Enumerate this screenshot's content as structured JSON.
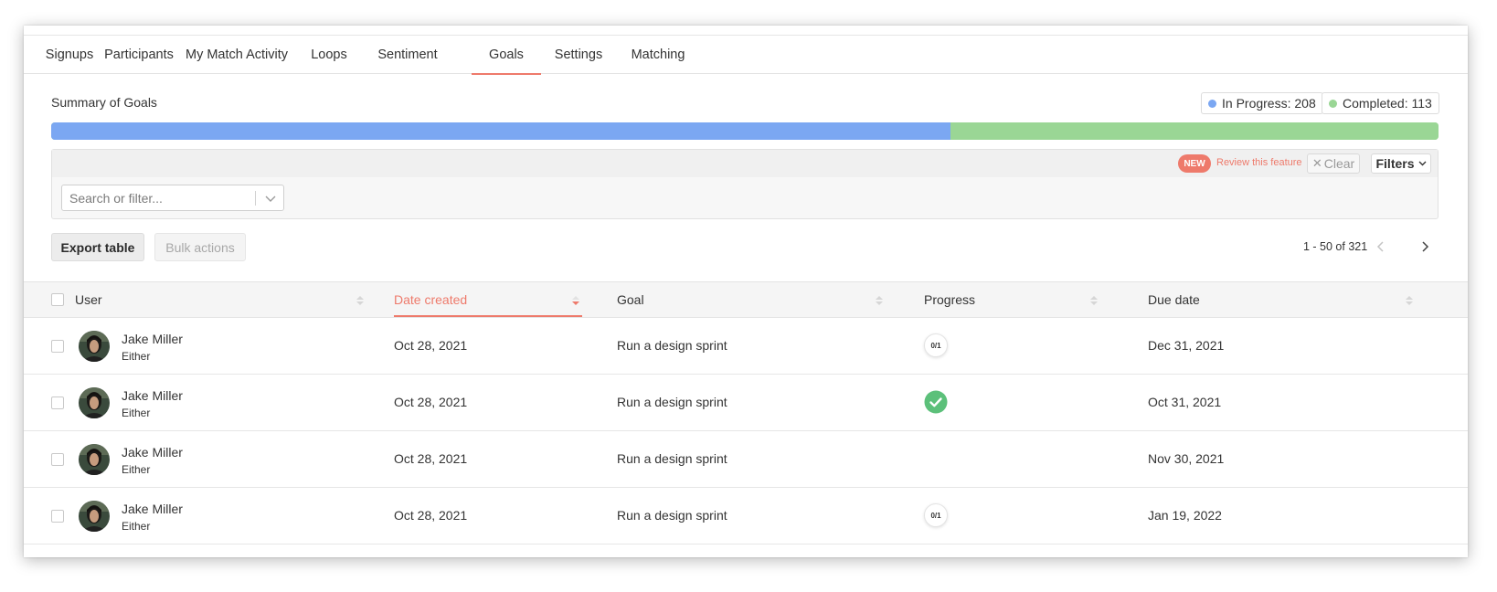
{
  "tabs": [
    {
      "label": "Signups"
    },
    {
      "label": "Participants"
    },
    {
      "label": "My Match Activity"
    },
    {
      "label": "Loops"
    },
    {
      "label": "Sentiment"
    },
    {
      "label": "Goals",
      "active": true
    },
    {
      "label": "Settings"
    },
    {
      "label": "Matching"
    }
  ],
  "summary": {
    "title": "Summary of Goals",
    "in_progress_label": "In Progress: 208",
    "completed_label": "Completed: 113",
    "in_progress_count": 208,
    "completed_count": 113,
    "in_progress_color": "#7ba7f2",
    "completed_color": "#9ad695"
  },
  "filter": {
    "new_badge": "NEW",
    "review_link": "Review this feature",
    "clear_label": "Clear",
    "filters_label": "Filters",
    "search_placeholder": "Search or filter..."
  },
  "toolbar": {
    "export_label": "Export table",
    "bulk_label": "Bulk actions",
    "pager_text": "1 - 50 of 321"
  },
  "table": {
    "columns": {
      "user": "User",
      "date_created": "Date created",
      "goal": "Goal",
      "progress": "Progress",
      "due_date": "Due date"
    },
    "rows": [
      {
        "name": "Jake Miller",
        "role": "Either",
        "date_created": "Oct 28, 2021",
        "goal": "Run a design sprint",
        "progress": "0/1",
        "progress_state": "partial",
        "due_date": "Dec 31, 2021"
      },
      {
        "name": "Jake Miller",
        "role": "Either",
        "date_created": "Oct 28, 2021",
        "goal": "Run a design sprint",
        "progress": "",
        "progress_state": "complete",
        "due_date": "Oct 31, 2021"
      },
      {
        "name": "Jake Miller",
        "role": "Either",
        "date_created": "Oct 28, 2021",
        "goal": "Run a design sprint",
        "progress": "",
        "progress_state": "none",
        "due_date": "Nov 30, 2021"
      },
      {
        "name": "Jake Miller",
        "role": "Either",
        "date_created": "Oct 28, 2021",
        "goal": "Run a design sprint",
        "progress": "0/1",
        "progress_state": "partial",
        "due_date": "Jan 19, 2022"
      }
    ]
  },
  "colors": {
    "accent": "#ee7a6b",
    "success": "#5cc07a"
  }
}
